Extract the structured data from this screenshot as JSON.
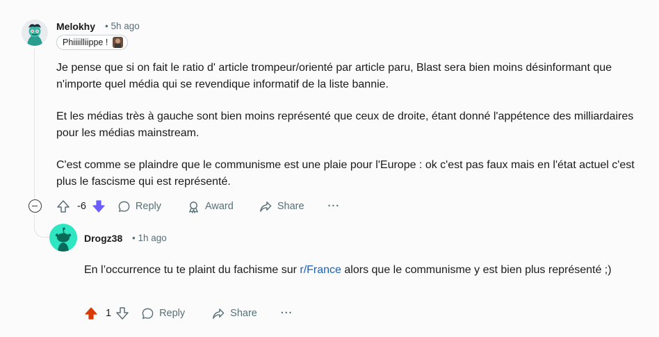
{
  "comment": {
    "author": "Melokhy",
    "time": "5h ago",
    "flair": "Phiiiilliippe !",
    "paragraphs": [
      "Je pense que si on fait le ratio d' article trompeur/orienté par article paru, Blast sera bien moins désinformant que n'importe quel média qui se revendique informatif de la liste bannie.",
      "Et les médias très à gauche sont bien moins représenté que ceux de droite, étant donné l'appétence des milliardaires pour les médias mainstream.",
      "C'est comme se plaindre que le communisme est une plaie pour l'Europe : ok c'est pas faux mais en l'état actuel c'est plus le fascisme qui est représenté."
    ],
    "score": "-6",
    "reply_label": "Reply",
    "award_label": "Award",
    "share_label": "Share",
    "more_label": "···",
    "downvote_color": "#6a5cff"
  },
  "reply": {
    "author": "Drogz38",
    "time": "1h ago",
    "text_before": "En l’occurrence tu te plaint du fachisme sur ",
    "link_text": "r/France",
    "text_after": " alors que le communisme y est bien plus représenté ;)",
    "score": "1",
    "reply_label": "Reply",
    "share_label": "Share",
    "more_label": "···",
    "upvote_color": "#d93a00"
  }
}
